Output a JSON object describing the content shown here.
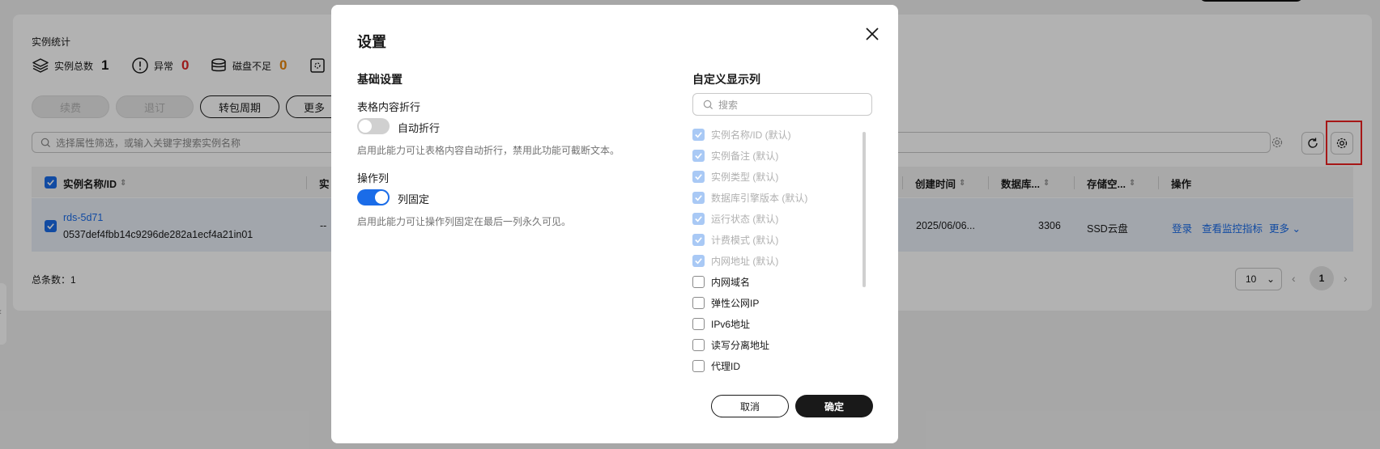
{
  "stats": {
    "title": "实例统计",
    "items": [
      {
        "label": "实例总数",
        "value": "1",
        "color": "#191919",
        "icon": "layers-icon"
      },
      {
        "label": "异常",
        "value": "0",
        "color": "#e02828",
        "icon": "alert-circle-icon"
      },
      {
        "label": "磁盘不足",
        "value": "0",
        "color": "#e8860c",
        "icon": "disk-icon"
      }
    ]
  },
  "toolbar": {
    "renew": "续费",
    "unsubscribe": "退订",
    "change_billing": "转包周期",
    "more": "更多"
  },
  "filter": {
    "placeholder": "选择属性筛选，或输入关键字搜索实例名称"
  },
  "table": {
    "headers": [
      "实例名称/ID",
      "实",
      "创建时间",
      "数据库...",
      "存储空...",
      "操作"
    ],
    "row": {
      "name": "rds-5d71",
      "id": "0537def4fbb14c9296de282a1ecf4a21in01",
      "remark": "--",
      "created": "2025/06/06...",
      "port": "3306",
      "storage": "SSD云盘",
      "actions": [
        "登录",
        "查看监控指标",
        "更多"
      ]
    }
  },
  "pagination": {
    "total": "总条数：1",
    "page_size": "10",
    "current_page": "1"
  },
  "modal": {
    "title": "设置",
    "basic_title": "基础设置",
    "wrap_label": "表格内容折行",
    "wrap_switch": "自动折行",
    "wrap_desc": "启用此能力可让表格内容自动折行，禁用此功能可截断文本。",
    "wrap_on": false,
    "action_label": "操作列",
    "action_switch": "列固定",
    "action_desc": "启用此能力可让操作列固定在最后一列永久可见。",
    "action_on": true,
    "custom_title": "自定义显示列",
    "search_placeholder": "搜索",
    "columns": [
      {
        "label": "实例名称/ID (默认)",
        "checked": true,
        "disabled": true
      },
      {
        "label": "实例备注 (默认)",
        "checked": true,
        "disabled": true
      },
      {
        "label": "实例类型 (默认)",
        "checked": true,
        "disabled": true
      },
      {
        "label": "数据库引擎版本 (默认)",
        "checked": true,
        "disabled": true
      },
      {
        "label": "运行状态 (默认)",
        "checked": true,
        "disabled": true
      },
      {
        "label": "计费模式 (默认)",
        "checked": true,
        "disabled": true
      },
      {
        "label": "内网地址 (默认)",
        "checked": true,
        "disabled": true
      },
      {
        "label": "内网域名",
        "checked": false,
        "disabled": false
      },
      {
        "label": "弹性公网IP",
        "checked": false,
        "disabled": false
      },
      {
        "label": "IPv6地址",
        "checked": false,
        "disabled": false
      },
      {
        "label": "读写分离地址",
        "checked": false,
        "disabled": false
      },
      {
        "label": "代理ID",
        "checked": false,
        "disabled": false
      }
    ],
    "cancel": "取消",
    "ok": "确定"
  },
  "colors": {
    "accent": "#1a6ce8",
    "primary_button": "#191919",
    "highlight_border": "#e22222"
  }
}
